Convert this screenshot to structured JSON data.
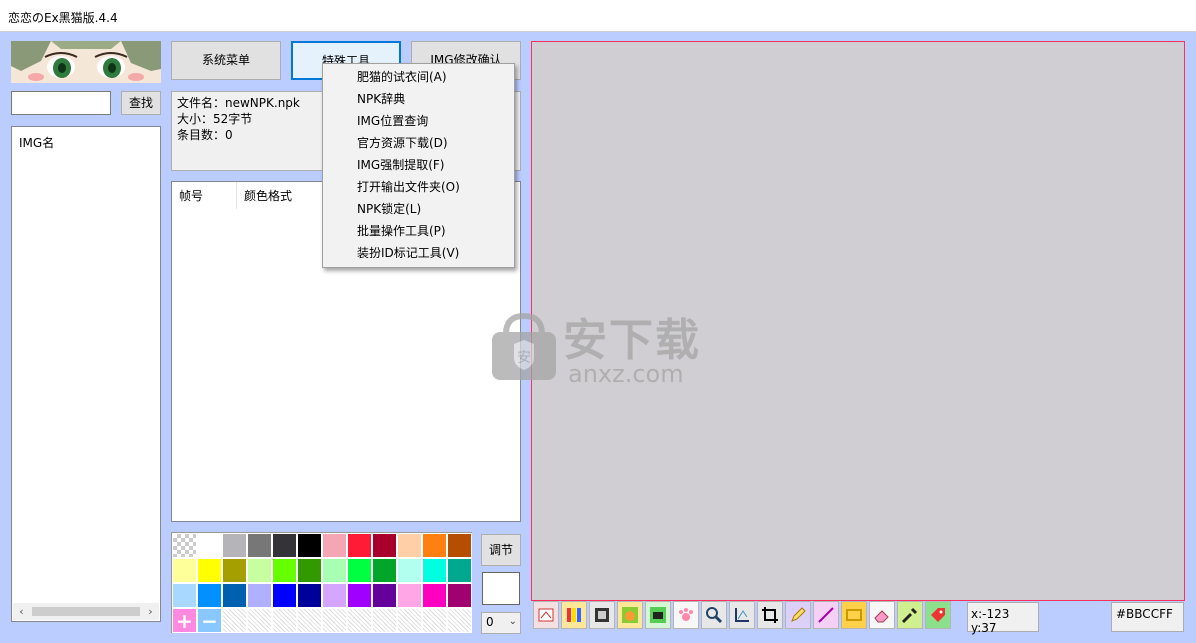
{
  "window": {
    "title": "恋恋のEx黑猫版.4.4"
  },
  "search": {
    "value": "",
    "button_label": "查找"
  },
  "img_list": {
    "header": "IMG名"
  },
  "top_buttons": {
    "system_menu": "系统菜单",
    "special_tools": "特殊工具",
    "img_modify": "IMG修改确认"
  },
  "file_info": {
    "filename_line": "文件名：newNPK.npk",
    "size_line": "大小：52字节",
    "count_line": "条目数：0"
  },
  "frame_list": {
    "col_frame": "帧号",
    "col_color_format": "颜色格式"
  },
  "special_tools_menu": {
    "items": [
      "肥猫的试衣间(A)",
      "NPK辞典",
      "IMG位置查询",
      "官方资源下载(D)",
      "IMG强制提取(F)",
      "打开输出文件夹(O)",
      "NPK锁定(L)",
      "批量操作工具(P)",
      "装扮ID标记工具(V)"
    ]
  },
  "palette": {
    "colors": [
      "transparent",
      "#FFFFFF",
      "#B5B5B9",
      "#777777",
      "#333338",
      "#000000",
      "#F4A6B4",
      "#FF1A35",
      "#A8002D",
      "#FFD0A8",
      "#FF7F10",
      "#B54E00",
      "#FFFF9A",
      "#FFFF00",
      "#A5A000",
      "#C7FFA0",
      "#66FF00",
      "#339900",
      "#A8FFB3",
      "#00FF40",
      "#00A52A",
      "#B2FFF0",
      "#00FFE0",
      "#00A890",
      "#A8D8FF",
      "#0090FF",
      "#0060B0",
      "#B0B0FF",
      "#0000FF",
      "#00009B",
      "#D4A6FF",
      "#A000FF",
      "#66009B",
      "#FFA6E6",
      "#FF00C0",
      "#A00070",
      "add",
      "remove",
      "empty",
      "empty",
      "empty",
      "empty",
      "empty",
      "empty",
      "empty",
      "empty",
      "empty",
      "empty"
    ],
    "add_label": "+",
    "remove_label": "−"
  },
  "adjust": {
    "button_label": "调节",
    "select_value": "0"
  },
  "status": {
    "coords": "x:-123 y:37",
    "color_hex": "#BBCCFF"
  },
  "watermark": {
    "main": "安下载",
    "sub": "anxz.com"
  },
  "theme": {
    "client_bg": "#BBCCFF",
    "canvas_bg": "#D0CED2",
    "canvas_border": "#FF3060"
  },
  "toolbar_icons": [
    "frame-edit-icon",
    "color-bars-icon",
    "film-icon",
    "cat-icon",
    "camera-icon",
    "paw-icon",
    "magnifier-icon",
    "axis-icon",
    "crop-icon",
    "pencil-icon",
    "line-icon",
    "rectangle-icon",
    "eraser-icon",
    "eyedropper-icon",
    "tag-icon"
  ]
}
